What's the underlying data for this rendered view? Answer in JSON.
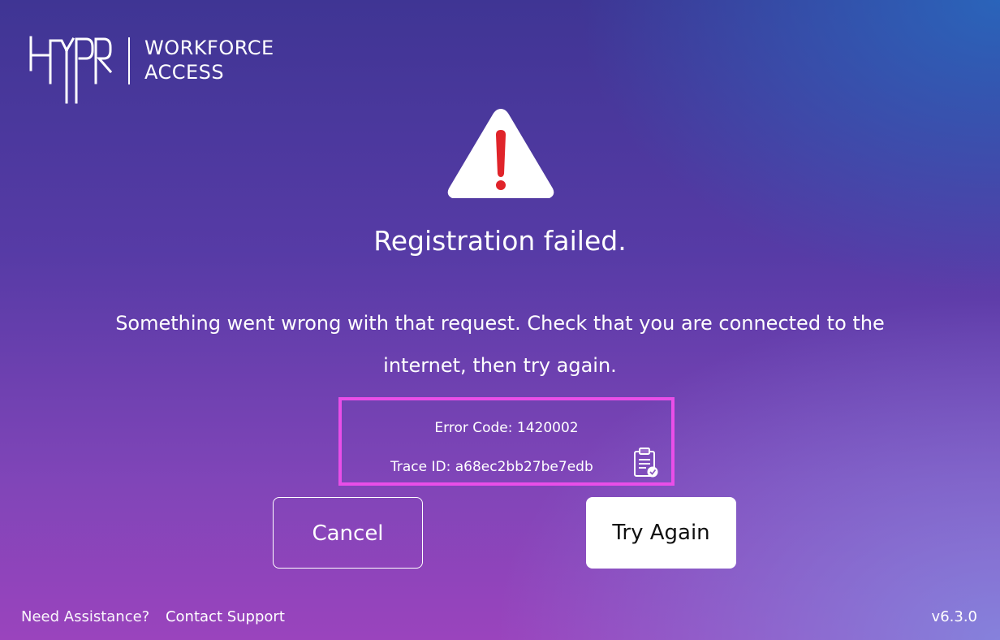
{
  "brand": {
    "logo_text": "HYPR",
    "product_line1": "WORKFORCE",
    "product_line2": "ACCESS"
  },
  "dialog": {
    "icon": "warning-triangle-icon",
    "title": "Registration failed.",
    "message": "Something went wrong with that request. Check that you are connected to the internet, then try again.",
    "error_code": "Error Code: 1420002",
    "trace_id": "Trace ID: a68ec2bb27be7edb",
    "copy_icon": "clipboard-check-icon"
  },
  "actions": {
    "cancel_label": "Cancel",
    "try_again_label": "Try Again"
  },
  "footer": {
    "need_assistance": "Need Assistance?",
    "contact_support": "Contact Support",
    "version": "v6.3.0"
  },
  "colors": {
    "highlight_border": "#e94ee8",
    "warning_mark": "#e0242a",
    "button_bg": "#ffffff"
  }
}
